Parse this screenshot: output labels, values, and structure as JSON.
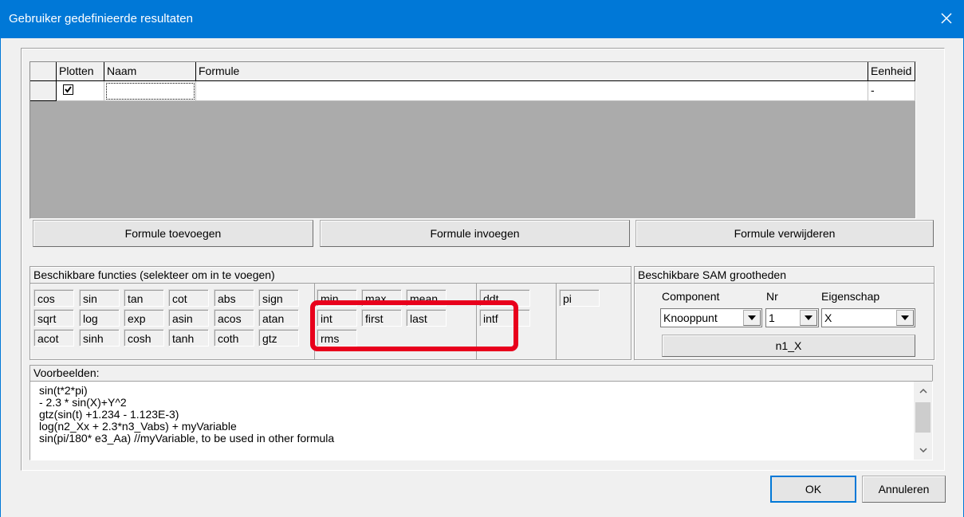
{
  "window": {
    "title": "Gebruiker gedefinieerde resultaten"
  },
  "grid": {
    "columns": [
      "Plotten",
      "Naam",
      "Formule",
      "Eenheid"
    ],
    "rows": [
      {
        "plotten": true,
        "naam": "",
        "formule": "",
        "eenheid": "-"
      }
    ]
  },
  "formula_buttons": {
    "add": "Formule toevoegen",
    "insert": "Formule invoegen",
    "delete": "Formule verwijderen"
  },
  "functions": {
    "title": "Beschikbare functies (selekteer om in te voegen)",
    "basic": [
      "cos",
      "sin",
      "tan",
      "cot",
      "abs",
      "sign",
      "sqrt",
      "log",
      "exp",
      "asin",
      "acos",
      "atan",
      "acot",
      "sinh",
      "cosh",
      "tanh",
      "coth",
      "gtz"
    ],
    "stats": [
      "min",
      "max",
      "mean",
      "int",
      "first",
      "last",
      "rms"
    ],
    "diff": [
      "ddt",
      "intf"
    ],
    "const": [
      "pi"
    ]
  },
  "sam": {
    "title": "Beschikbare SAM grootheden",
    "component_label": "Component",
    "nr_label": "Nr",
    "property_label": "Eigenschap",
    "component_value": "Knooppunt",
    "nr_value": "1",
    "property_value": "X",
    "result_button": "n1_X"
  },
  "examples": {
    "label": "Voorbeelden:",
    "lines": [
      "sin(t*2*pi)",
      "- 2.3 * sin(X)+Y^2",
      "gtz(sin(t) +1.234 - 1.123E-3)",
      "log(n2_Xx + 2.3*n3_Vabs) + myVariable",
      "sin(pi/180* e3_Aa)   //myVariable, to be used in other formula"
    ]
  },
  "dialog_buttons": {
    "ok": "OK",
    "cancel": "Annuleren"
  },
  "colors": {
    "titlebar": "#0078d7",
    "highlight": "#e8001c"
  }
}
